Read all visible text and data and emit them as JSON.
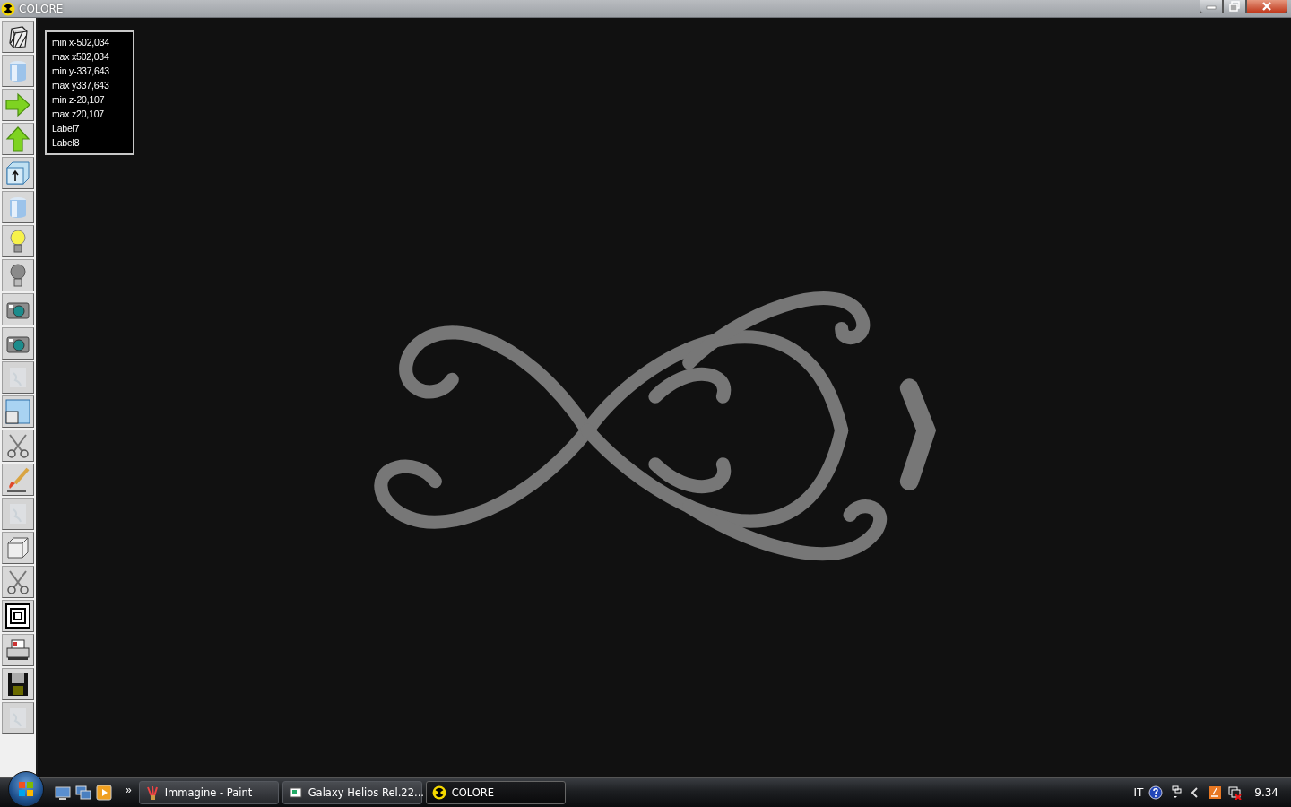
{
  "window": {
    "title": "COLORE"
  },
  "toolbar": [
    {
      "kind": "wireframe",
      "disabled": false
    },
    {
      "kind": "cylinder",
      "disabled": false
    },
    {
      "kind": "arrow-right",
      "disabled": false
    },
    {
      "kind": "arrow-up",
      "disabled": false
    },
    {
      "kind": "box-arrow",
      "disabled": false
    },
    {
      "kind": "cylinder",
      "disabled": false
    },
    {
      "kind": "bulb-on",
      "disabled": false
    },
    {
      "kind": "bulb-off",
      "disabled": false
    },
    {
      "kind": "camera",
      "disabled": false
    },
    {
      "kind": "camera",
      "disabled": false
    },
    {
      "kind": "texture",
      "disabled": true
    },
    {
      "kind": "windows",
      "disabled": false
    },
    {
      "kind": "scissors",
      "disabled": false
    },
    {
      "kind": "brush",
      "disabled": false
    },
    {
      "kind": "texture",
      "disabled": true
    },
    {
      "kind": "cube",
      "disabled": false
    },
    {
      "kind": "scissors",
      "disabled": false
    },
    {
      "kind": "squares",
      "disabled": false
    },
    {
      "kind": "printer",
      "disabled": false
    },
    {
      "kind": "floppy",
      "disabled": false
    },
    {
      "kind": "texture",
      "disabled": true
    }
  ],
  "info_labels": [
    "min x-502,034",
    "max x502,034",
    "min y-337,643",
    "max y337,643",
    "min z-20,107",
    "max z20,107",
    "Label7",
    "Label8"
  ],
  "taskbar": {
    "overflow": "»",
    "buttons": [
      {
        "label": "Immagine - Paint",
        "kind": "paint",
        "selected": false
      },
      {
        "label": "Galaxy Helios  Rel.22...",
        "kind": "helios",
        "selected": false
      },
      {
        "label": "COLORE",
        "kind": "colore",
        "selected": true
      }
    ],
    "language": "IT",
    "clock": "9.34"
  }
}
